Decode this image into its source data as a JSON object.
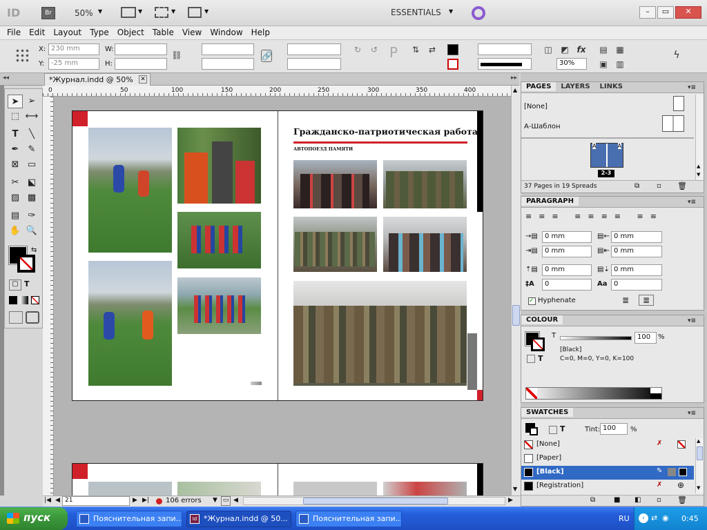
{
  "app": {
    "logo": "ID",
    "bridge": "Br",
    "zoom": "50%",
    "workspace": "ESSENTIALS",
    "window_controls": [
      "–",
      "▭",
      "✕"
    ]
  },
  "menu": [
    "File",
    "Edit",
    "Layout",
    "Type",
    "Object",
    "Table",
    "View",
    "Window",
    "Help"
  ],
  "control": {
    "x_label": "X:",
    "x_value": "230 mm",
    "y_label": "Y:",
    "y_value": "-25 mm",
    "w_label": "W:",
    "h_label": "H:",
    "opacity": "30%"
  },
  "document_tab": "*Журнал.indd @ 50%",
  "ruler_ticks": [
    "0",
    "50",
    "100",
    "150",
    "200",
    "250",
    "300",
    "350",
    "400"
  ],
  "spread": {
    "heading": "Гражданско-патриотическая работа",
    "subheading": "АВТОПОЕЗД ПАМЯТИ"
  },
  "status": {
    "page": "21",
    "errors": "106 errors"
  },
  "pages_panel": {
    "tabs": [
      "PAGES",
      "LAYERS",
      "LINKS"
    ],
    "none_master": "[None]",
    "a_master": "А-Шаблон",
    "spread_label": "2-3",
    "master_badge": "A",
    "summary": "37 Pages in 19 Spreads"
  },
  "paragraph_panel": {
    "title": "PARAGRAPH",
    "indent_left": "0 mm",
    "indent_right": "0 mm",
    "first_line": "0 mm",
    "last_line": "0 mm",
    "space_before": "0 mm",
    "space_after": "0 mm",
    "drop_lines": "0",
    "drop_chars": "0",
    "hyphenate": "Hyphenate"
  },
  "colour_panel": {
    "title": "COLOUR",
    "t_label": "T",
    "tint": "100",
    "percent": "%",
    "name": "[Black]",
    "values": "C=0, M=0, Y=0, K=100"
  },
  "swatches_panel": {
    "title": "SWATCHES",
    "tint_label": "Tint:",
    "tint": "100",
    "percent": "%",
    "items": [
      "[None]",
      "[Paper]",
      "[Black]",
      "[Registration]"
    ],
    "selected_color": "#316ac5"
  },
  "taskbar": {
    "start": "пуск",
    "tasks": [
      "Пояснительная запи...",
      "*Журнал.indd @ 50...",
      "Пояснительная запи..."
    ],
    "lang": "RU",
    "clock": "0:45"
  },
  "colors": {
    "accent_red": "#d0202a",
    "taskbar_blue": "#245edb",
    "start_green": "#3c9a3c"
  }
}
